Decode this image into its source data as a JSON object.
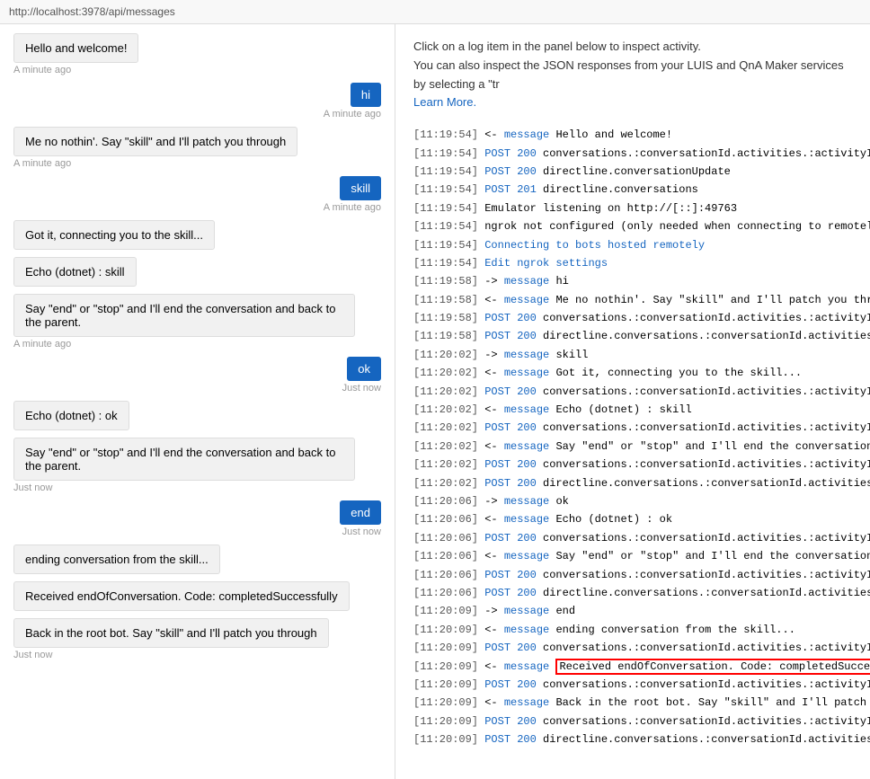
{
  "topBar": {
    "url": "http://localhost:3978/api/messages"
  },
  "chat": {
    "messages": [
      {
        "type": "bot",
        "text": "Hello and welcome!",
        "time": "A minute ago"
      },
      {
        "type": "user",
        "text": "hi",
        "time": "A minute ago"
      },
      {
        "type": "bot",
        "text": "Me no nothin'. Say \"skill\" and I'll patch you through",
        "time": "A minute ago"
      },
      {
        "type": "user",
        "text": "skill",
        "time": "A minute ago"
      },
      {
        "type": "bot",
        "text": "Got it, connecting you to the skill...",
        "time": null
      },
      {
        "type": "bot",
        "text": "Echo (dotnet) : skill",
        "time": null
      },
      {
        "type": "bot",
        "text": "Say \"end\" or \"stop\" and I'll end the conversation and back to the parent.",
        "time": "A minute ago"
      },
      {
        "type": "user",
        "text": "ok",
        "time": "Just now"
      },
      {
        "type": "bot",
        "text": "Echo (dotnet) : ok",
        "time": null
      },
      {
        "type": "bot",
        "text": "Say \"end\" or \"stop\" and I'll end the conversation and back to the parent.",
        "time": "Just now"
      },
      {
        "type": "user",
        "text": "end",
        "time": "Just now"
      },
      {
        "type": "bot",
        "text": "ending conversation from the skill...",
        "time": null
      },
      {
        "type": "bot",
        "text": "Received endOfConversation.\nCode: completedSuccessfully",
        "time": null
      },
      {
        "type": "bot",
        "text": "Back in the root bot. Say \"skill\" and I'll patch you through",
        "time": "Just now"
      }
    ]
  },
  "logPanel": {
    "intro1": "Click on a log item in the panel below to inspect activity.",
    "intro2": "You can also inspect the JSON responses from your LUIS and QnA Maker services by selecting a \"tr",
    "learnMore": "Learn More.",
    "entries": [
      {
        "time": "11:19:54",
        "dir": "<-",
        "type": "message",
        "text": "Hello and welcome!"
      },
      {
        "time": "11:19:54",
        "dir": null,
        "type": "POST 200",
        "text": "conversations.:conversationId.activities.:activityId"
      },
      {
        "time": "11:19:54",
        "dir": null,
        "type": "POST 200",
        "text": "directline.conversationUpdate"
      },
      {
        "time": "11:19:54",
        "dir": null,
        "type": "POST 201",
        "text": "directline.conversations"
      },
      {
        "time": "11:19:54",
        "dir": null,
        "type": "plain",
        "text": "Emulator listening on http://[::]:49763"
      },
      {
        "time": "11:19:54",
        "dir": null,
        "type": "plain",
        "text": "ngrok not configured (only needed when connecting to remotely hoste"
      },
      {
        "time": "11:19:54",
        "dir": null,
        "type": "link",
        "text": "Connecting to bots hosted remotely"
      },
      {
        "time": "11:19:54",
        "dir": null,
        "type": "link",
        "text": "Edit ngrok settings"
      },
      {
        "time": "11:19:58",
        "dir": "->",
        "type": "message",
        "text": "hi"
      },
      {
        "time": "11:19:58",
        "dir": "<-",
        "type": "message",
        "text": "Me no nothin'. Say \"skill\" and I'll patch you thro..."
      },
      {
        "time": "11:19:58",
        "dir": null,
        "type": "POST 200",
        "text": "conversations.:conversationId.activities.:activityId"
      },
      {
        "time": "11:19:58",
        "dir": null,
        "type": "POST 200",
        "text": "directline.conversations.:conversationId.activities"
      },
      {
        "time": "11:20:02",
        "dir": "->",
        "type": "message",
        "text": "skill"
      },
      {
        "time": "11:20:02",
        "dir": "<-",
        "type": "message",
        "text": "Got it, connecting you to the skill..."
      },
      {
        "time": "11:20:02",
        "dir": null,
        "type": "POST 200",
        "text": "conversations.:conversationId.activities.:activityId"
      },
      {
        "time": "11:20:02",
        "dir": "<-",
        "type": "message",
        "text": "Echo (dotnet) : skill"
      },
      {
        "time": "11:20:02",
        "dir": null,
        "type": "POST 200",
        "text": "conversations.:conversationId.activities.:activityId"
      },
      {
        "time": "11:20:02",
        "dir": "<-",
        "type": "message",
        "text": "Say \"end\" or \"stop\" and I'll end the conversation ..."
      },
      {
        "time": "11:20:02",
        "dir": null,
        "type": "POST 200",
        "text": "conversations.:conversationId.activities.:activityId"
      },
      {
        "time": "11:20:02",
        "dir": null,
        "type": "POST 200",
        "text": "directline.conversations.:conversationId.activities"
      },
      {
        "time": "11:20:06",
        "dir": "->",
        "type": "message",
        "text": "ok"
      },
      {
        "time": "11:20:06",
        "dir": "<-",
        "type": "message",
        "text": "Echo (dotnet) : ok"
      },
      {
        "time": "11:20:06",
        "dir": null,
        "type": "POST 200",
        "text": "conversations.:conversationId.activities.:activityId"
      },
      {
        "time": "11:20:06",
        "dir": "<-",
        "type": "message",
        "text": "Say \"end\" or \"stop\" and I'll end the conversation ..."
      },
      {
        "time": "11:20:06",
        "dir": null,
        "type": "POST 200",
        "text": "conversations.:conversationId.activities.:activityId"
      },
      {
        "time": "11:20:06",
        "dir": null,
        "type": "POST 200",
        "text": "directline.conversations.:conversationId.activities"
      },
      {
        "time": "11:20:09",
        "dir": "->",
        "type": "message",
        "text": "end"
      },
      {
        "time": "11:20:09",
        "dir": "<-",
        "type": "message",
        "text": "ending conversation from the skill..."
      },
      {
        "time": "11:20:09",
        "dir": null,
        "type": "POST 200",
        "text": "conversations.:conversationId.activities.:activityId"
      },
      {
        "time": "11:20:09",
        "dir": "<-",
        "type": "message_highlight",
        "text": "Received endOfConversation. Code: completedSucces..."
      },
      {
        "time": "11:20:09",
        "dir": null,
        "type": "POST 200",
        "text": "conversations.:conversationId.activities.:activityId"
      },
      {
        "time": "11:20:09",
        "dir": "<-",
        "type": "message",
        "text": "Back in the root bot. Say \"skill\" and I'll patch y..."
      },
      {
        "time": "11:20:09",
        "dir": null,
        "type": "POST 200",
        "text": "conversations.:conversationId.activities.:activityId"
      },
      {
        "time": "11:20:09",
        "dir": null,
        "type": "POST 200",
        "text": "directline.conversations.:conversationId.activities"
      }
    ]
  }
}
